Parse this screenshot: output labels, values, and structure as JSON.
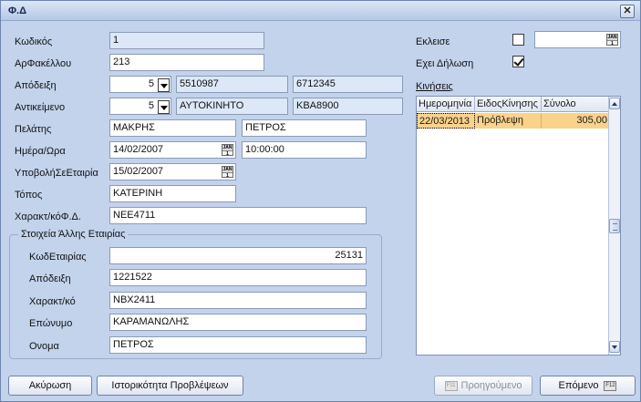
{
  "window": {
    "title": "Φ.Δ",
    "close_label": "✕"
  },
  "form": {
    "kodikos": {
      "label": "Κωδικός",
      "value": "1"
    },
    "arfakelou": {
      "label": "ΑρΦακέλλου",
      "value": "213"
    },
    "apodeixi": {
      "label": "Απόδειξη",
      "select": "5",
      "value1": "5510987",
      "value2": "6712345"
    },
    "antikeimeno": {
      "label": "Αντικείμενο",
      "select": "5",
      "value1": "ΑΥΤΟΚΙΝΗΤΟ",
      "value2": "ΚΒΑ8900"
    },
    "pelatis": {
      "label": "Πελάτης",
      "surname": "ΜΑΚΡΗΣ",
      "name": "ΠΕΤΡΟΣ"
    },
    "imera_ora": {
      "label": "Ημέρα/Ωρα",
      "date": "14/02/2007",
      "time": "10:00:00"
    },
    "ypovoli": {
      "label": "ΥποβολήΣεΕταιρία",
      "date": "15/02/2007"
    },
    "topos": {
      "label": "Τόπος",
      "value": "ΚΑΤΕΡΙΝΗ"
    },
    "charakt": {
      "label": "Χαρακτ/κόΦ.Δ.",
      "value": "ΝΕΕ4711"
    },
    "other_company": {
      "title": "Στοιχεία Άλλης Εταιρίας",
      "kod_etairias": {
        "label": "ΚωδΕταιρίας",
        "value": "25131"
      },
      "apodeixi": {
        "label": "Απόδειξη",
        "value": "1221522"
      },
      "charakt": {
        "label": "Χαρακτ/κό",
        "value": "ΝΒΧ2411"
      },
      "eponymo": {
        "label": "Επώνυμο",
        "value": "ΚΑΡΑΜΑΝΩΛΗΣ"
      },
      "onoma": {
        "label": "Ονομα",
        "value": "ΠΕΤΡΟΣ"
      }
    },
    "ekleise": {
      "label": "Εκλεισε",
      "checked": false,
      "date": ""
    },
    "dilosi": {
      "label": "Εχει Δήλωση",
      "checked": true
    },
    "kiniseis": {
      "label": "Κινήσεις"
    }
  },
  "grid": {
    "columns": [
      "Ημερομηνία",
      "ΕιδοςΚίνησης",
      "Σύνολο"
    ],
    "rows": [
      {
        "date": "22/03/2013",
        "type": "Πρόβλεψη",
        "total": "305,00"
      }
    ]
  },
  "buttons": {
    "cancel": "Ακύρωση",
    "history": "Ιστορικότητα Προβλέψεων",
    "previous": "Προηγούμενο",
    "previous_key": "F11",
    "next": "Επόμενο",
    "next_key": "F12"
  },
  "icons": {
    "calendar": "calendar-icon",
    "calendar_text": "JAN"
  },
  "colors": {
    "window_bg": "#c3d3ec",
    "readonly_bg": "#dce8f7",
    "grid_selected_row": "#fbd28a"
  }
}
